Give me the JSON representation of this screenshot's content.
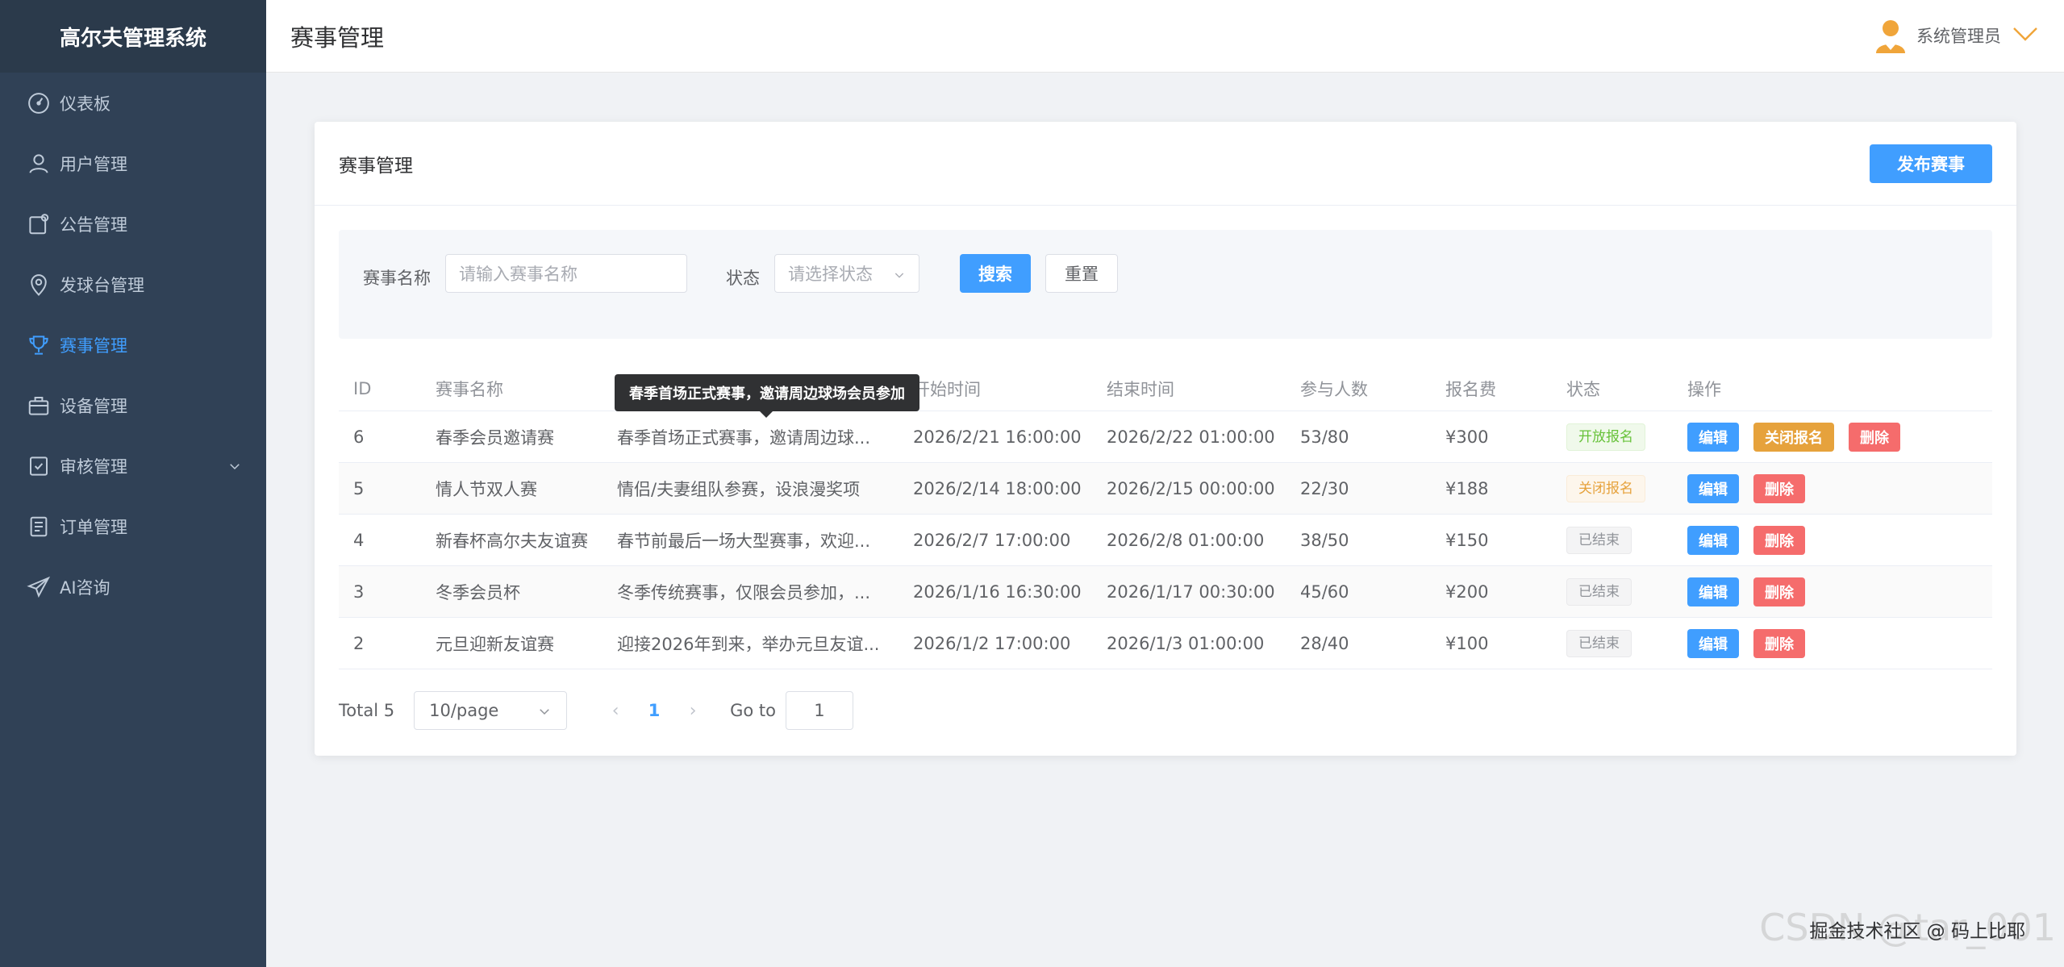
{
  "app": {
    "title": "高尔夫管理系统"
  },
  "sidebar": {
    "items": [
      {
        "label": "仪表板",
        "icon": "dashboard-icon"
      },
      {
        "label": "用户管理",
        "icon": "user-icon"
      },
      {
        "label": "公告管理",
        "icon": "notice-icon"
      },
      {
        "label": "发球台管理",
        "icon": "location-icon"
      },
      {
        "label": "赛事管理",
        "icon": "trophy-icon",
        "active": true
      },
      {
        "label": "设备管理",
        "icon": "briefcase-icon"
      },
      {
        "label": "审核管理",
        "icon": "checklist-icon",
        "expandable": true
      },
      {
        "label": "订单管理",
        "icon": "document-icon"
      },
      {
        "label": "AI咨询",
        "icon": "send-icon"
      }
    ]
  },
  "header": {
    "title": "赛事管理",
    "user": "系统管理员"
  },
  "card": {
    "title": "赛事管理",
    "publish_button": "发布赛事"
  },
  "search": {
    "name_label": "赛事名称",
    "name_placeholder": "请输入赛事名称",
    "status_label": "状态",
    "status_placeholder": "请选择状态",
    "search_button": "搜索",
    "reset_button": "重置"
  },
  "table": {
    "columns": [
      "ID",
      "赛事名称",
      "开始时间",
      "结束时间",
      "参与人数",
      "报名费",
      "状态",
      "操作"
    ],
    "rows": [
      {
        "id": "6",
        "name": "春季会员邀请赛",
        "desc": "春季首场正式赛事，邀请周边球...",
        "start": "2026/2/21 16:00:00",
        "end": "2026/2/22 01:00:00",
        "num": "53/80",
        "fee": "¥300",
        "status": "开放报名",
        "status_type": "success",
        "ops": [
          "编辑",
          "关闭报名",
          "删除"
        ]
      },
      {
        "id": "5",
        "name": "情人节双人赛",
        "desc": "情侣/夫妻组队参赛，设浪漫奖项",
        "start": "2026/2/14 18:00:00",
        "end": "2026/2/15 00:00:00",
        "num": "22/30",
        "fee": "¥188",
        "status": "关闭报名",
        "status_type": "warning",
        "ops": [
          "编辑",
          "删除"
        ]
      },
      {
        "id": "4",
        "name": "新春杯高尔夫友谊赛",
        "desc": "春节前最后一场大型赛事，欢迎...",
        "start": "2026/2/7 17:00:00",
        "end": "2026/2/8 01:00:00",
        "num": "38/50",
        "fee": "¥150",
        "status": "已结束",
        "status_type": "info",
        "ops": [
          "编辑",
          "删除"
        ]
      },
      {
        "id": "3",
        "name": "冬季会员杯",
        "desc": "冬季传统赛事，仅限会员参加，...",
        "start": "2026/1/16 16:30:00",
        "end": "2026/1/17 00:30:00",
        "num": "45/60",
        "fee": "¥200",
        "status": "已结束",
        "status_type": "info",
        "ops": [
          "编辑",
          "删除"
        ]
      },
      {
        "id": "2",
        "name": "元旦迎新友谊赛",
        "desc": "迎接2026年到来，举办元旦友谊...",
        "start": "2026/1/2 17:00:00",
        "end": "2026/1/3 01:00:00",
        "num": "28/40",
        "fee": "¥100",
        "status": "已结束",
        "status_type": "info",
        "ops": [
          "编辑",
          "删除"
        ]
      }
    ]
  },
  "tooltip": "春季首场正式赛事，邀请周边球场会员参加",
  "pagination": {
    "total": "Total 5",
    "page_size": "10/page",
    "prev": "‹",
    "current": "1",
    "next": "›",
    "goto_label": "Go to",
    "goto_value": "1"
  },
  "watermark": {
    "faded": "CSDN @tar_001",
    "text": "掘金技术社区 @ 码上比耶"
  },
  "colors": {
    "primary": "#409eff",
    "sidebar": "#304156",
    "warning": "#e6a23c",
    "danger": "#f56c6c",
    "success": "#67c23a"
  }
}
